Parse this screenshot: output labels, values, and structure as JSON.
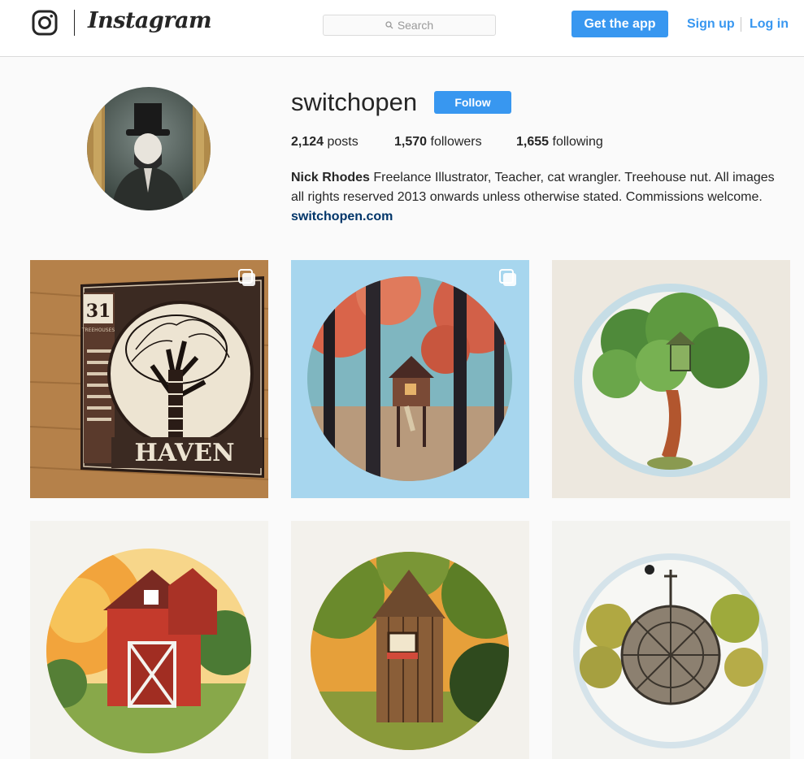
{
  "header": {
    "brand": "Instagram",
    "search_placeholder": "Search",
    "get_app_label": "Get the app",
    "signup_label": "Sign up",
    "login_label": "Log in"
  },
  "profile": {
    "username": "switchopen",
    "follow_label": "Follow",
    "stats": [
      {
        "count": "2,124",
        "label": "posts"
      },
      {
        "count": "1,570",
        "label": "followers"
      },
      {
        "count": "1,655",
        "label": "following"
      }
    ],
    "full_name": "Nick Rhodes",
    "bio": " Freelance Illustrator, Teacher, cat wrangler. Treehouse nut. All images all rights reserved 2013 onwards unless otherwise stated. Commissions welcome.",
    "website": "switchopen.com"
  },
  "posts": [
    {
      "image": "haven-31-treehouse-card",
      "card_number": "31",
      "card_word": "HAVEN",
      "card_small": "TREEHOUSES",
      "multiple": true
    },
    {
      "image": "autumn-forest-treehouse-circle",
      "multiple": true
    },
    {
      "image": "green-tree-treehouse-circle",
      "multiple": false
    },
    {
      "image": "red-barn-sunset-circle",
      "multiple": false
    },
    {
      "image": "wooden-shack-green-trees-circle",
      "multiple": false
    },
    {
      "image": "circular-tower-treehouse-circle",
      "multiple": false
    }
  ],
  "colors": {
    "accent": "#3897f0",
    "link_dark": "#003569",
    "text": "#262626",
    "background": "#fafafa"
  }
}
